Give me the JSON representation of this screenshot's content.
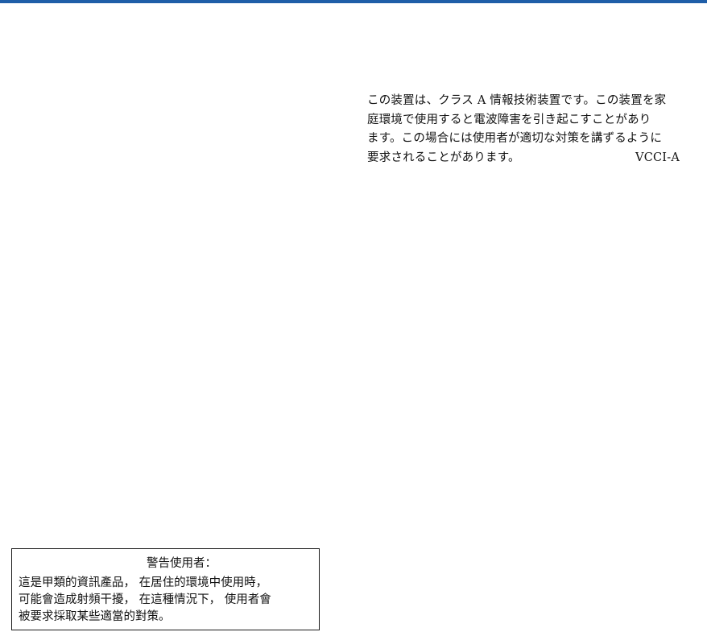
{
  "colors": {
    "top_rule": "#1f5ea8",
    "text": "#111111",
    "border": "#1a1a1a"
  },
  "vcci_notice": {
    "lines": [
      "この装置は、クラス A 情報技術装置です。この装置を家",
      "庭環境で使用すると電波障害を引き起こすことがあり",
      "ます。この場合には使用者が適切な対策を講ずるように",
      "要求されることがあります。"
    ],
    "class_label": "VCCI-A"
  },
  "bsmi_notice": {
    "title": "警告使用者：",
    "lines": [
      "這是甲類的資訊產品， 在居住的環境中使用時，",
      "可能會造成射頻干擾， 在這種情況下， 使用者會",
      "被要求採取某些適當的對策。"
    ]
  }
}
